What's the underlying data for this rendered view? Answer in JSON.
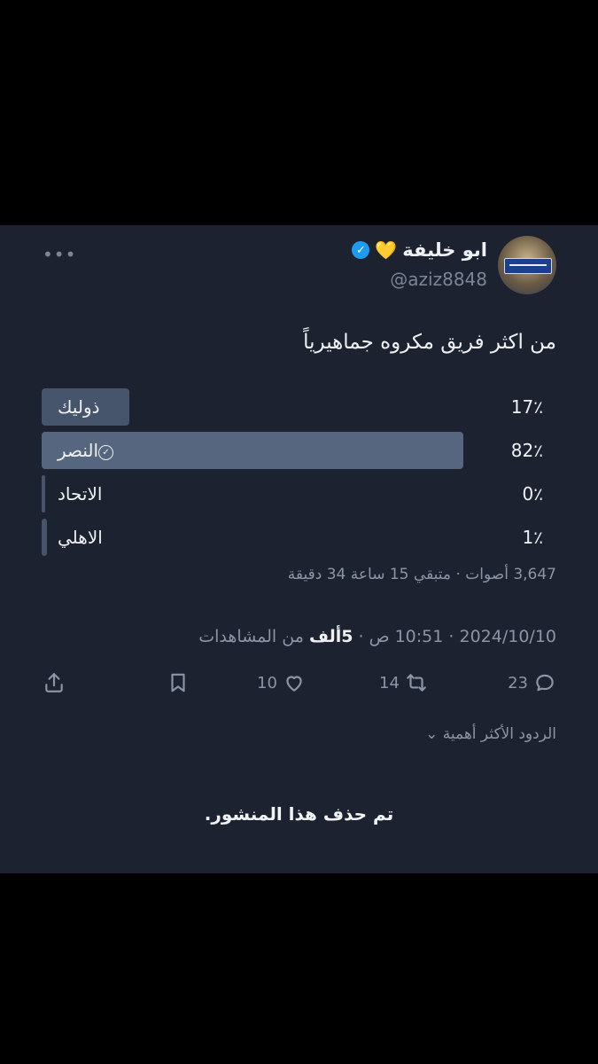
{
  "post": {
    "author_name": "ابو خليفة",
    "name_emoji": "💛",
    "handle": "@aziz8848",
    "more_label": "•••",
    "question": "من اكثر فريق مكروه جماهيرياً"
  },
  "poll": {
    "options": [
      {
        "label": "ذوليك",
        "percent": "17٪",
        "value": 17,
        "winner": false
      },
      {
        "label": "النصر",
        "percent": "82٪",
        "value": 82,
        "winner": true
      },
      {
        "label": "الاتحاد",
        "percent": "0٪",
        "value": 0,
        "winner": false
      },
      {
        "label": "الاهلي",
        "percent": "1٪",
        "value": 1,
        "winner": false
      }
    ],
    "meta": "3,647 أصوات · متبقي 15 ساعة 34 دقيقة"
  },
  "timestamp": {
    "datetime": "2024/10/10 · 10:51 ص · ",
    "views_count": "5ألف",
    "views_suffix": " من المشاهدات"
  },
  "actions": {
    "replies": "23",
    "reposts": "14",
    "likes": "10"
  },
  "replies_sort_label": "الردود الأكثر أهمية",
  "deleted_notice": "تم حذف هذا المنشور."
}
